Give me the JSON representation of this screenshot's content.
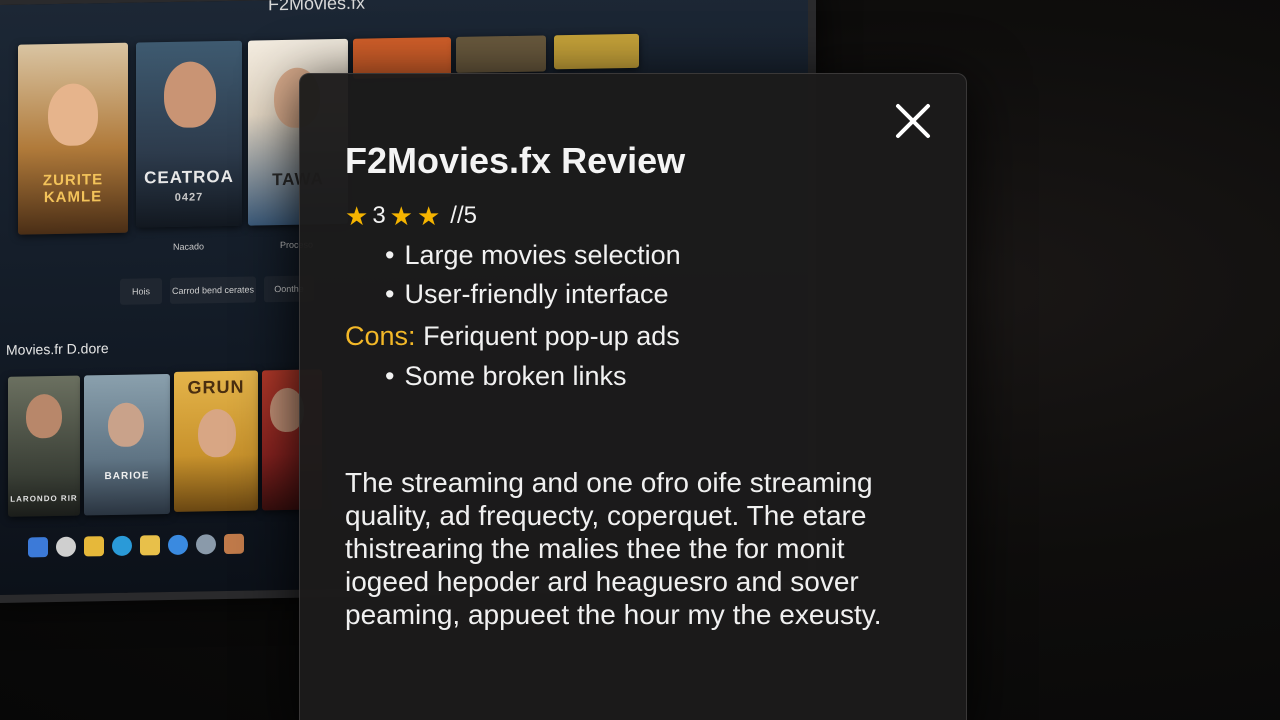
{
  "background": {
    "site_title": "F2Movies.fx",
    "posters_top": [
      {
        "title": "ZURITE KAMLE",
        "caption": "",
        "color": "#b07a3a"
      },
      {
        "title": "CEATROA",
        "sub": "0427",
        "caption": "Nacado",
        "color": "#2d3b4c"
      },
      {
        "title": "TAWA",
        "caption": "Proceso",
        "color": "#e4d7c4"
      },
      {
        "title": "",
        "caption": "",
        "color": "#d4602a"
      },
      {
        "title": "",
        "caption": "",
        "color": "#6a5a3e"
      },
      {
        "title": "",
        "caption": "",
        "color": "#c8a43a"
      }
    ],
    "filter_buttons": [
      "Hois",
      "Carrod bend cerates",
      "Oonthe"
    ],
    "row_label": "Movies.fr D.dore",
    "posters_bottom": [
      {
        "title": "LARONDO RIR",
        "color": "#3a3f36"
      },
      {
        "title": "BARIOE",
        "color": "#5f7484"
      },
      {
        "title": "GRUN",
        "color": "#c8922c"
      },
      {
        "title": "",
        "color": "#8a2320"
      }
    ]
  },
  "modal": {
    "title": "F2Movies.fx Review",
    "rating": {
      "value": "3",
      "scale": "//5",
      "stars_shown": 3
    },
    "pros": [
      "Large movies selection",
      "User-friendly interface"
    ],
    "cons_label": "Cons:",
    "cons": [
      "Feriquent pop-up ads",
      "Some broken links"
    ],
    "body": "The streaming and one ofro oife streaming quality, ad frequecty, coperquet. The etare thistrearing the malies thee the for monit iogeed hepoder ard heaguesro and sover peaming, appueet the hour my the exeusty.",
    "close_icon": "close-icon"
  },
  "colors": {
    "accent": "#f3b828",
    "star": "#f5b400",
    "modal_bg": "#1c1b1b"
  }
}
